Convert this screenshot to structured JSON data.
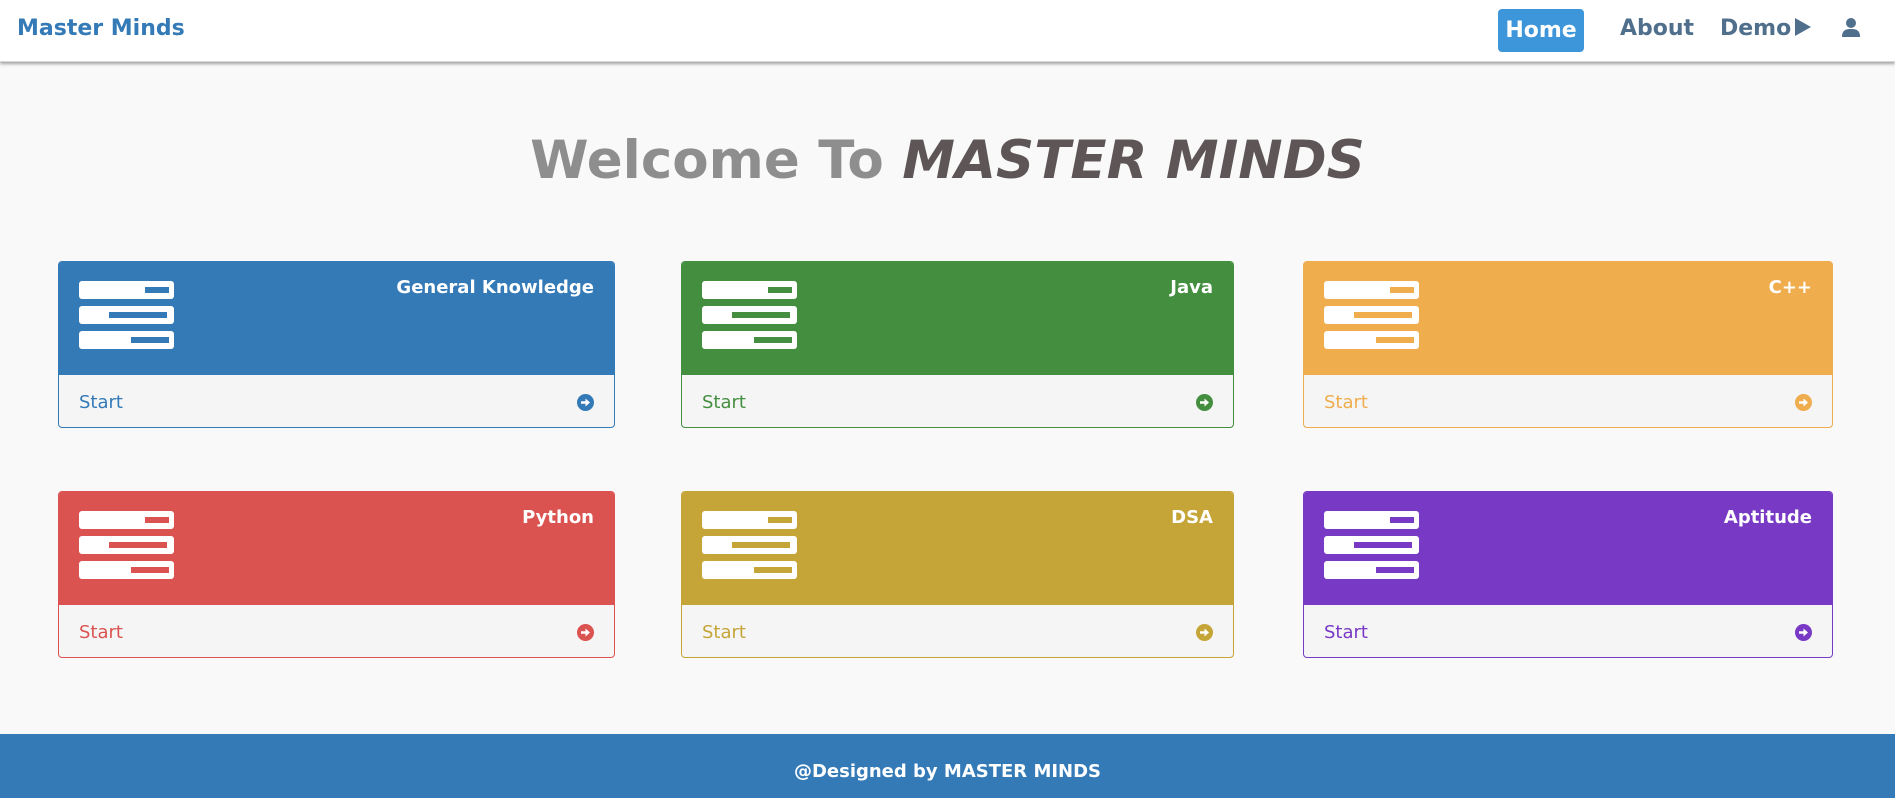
{
  "navbar": {
    "brand": "Master Minds",
    "items": [
      {
        "label": "Home"
      },
      {
        "label": "About"
      },
      {
        "label": "Demo"
      }
    ]
  },
  "hero": {
    "prefix": "Welcome To",
    "emphasis": "MASTER MINDS"
  },
  "cards": [
    {
      "title": "General Knowledge",
      "action": "Start",
      "color": "#337ab7"
    },
    {
      "title": "Java",
      "action": "Start",
      "color": "#448f3f"
    },
    {
      "title": "C++",
      "action": "Start",
      "color": "#efad4e"
    },
    {
      "title": "Python",
      "action": "Start",
      "color": "#db5350"
    },
    {
      "title": "DSA",
      "action": "Start",
      "color": "#c5a537"
    },
    {
      "title": "Aptitude",
      "action": "Start",
      "color": "#7839c5"
    }
  ],
  "icons": {
    "user": "user-icon",
    "card_icon": "list-icon",
    "card_action": "circle-arrow-right-icon",
    "demo": "play-triangle-icon"
  },
  "footer": {
    "text": "@Designed by MASTER MINDS"
  }
}
